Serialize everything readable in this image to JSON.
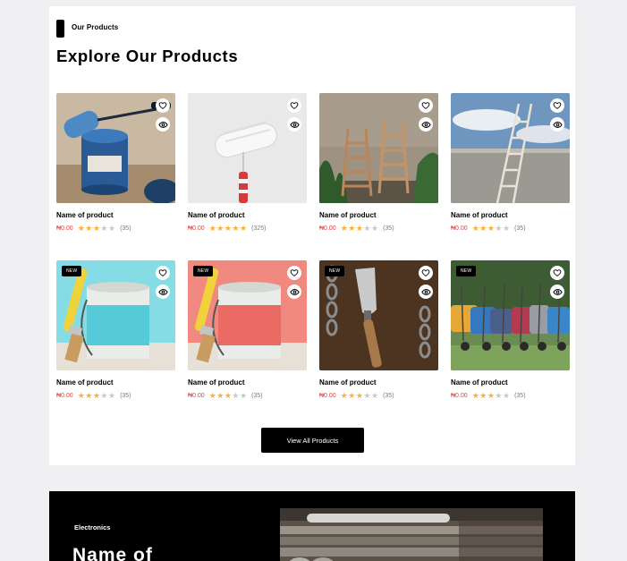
{
  "section": {
    "tag": "Our Products",
    "title": "Explore Our Products"
  },
  "products": [
    {
      "name": "Name of product",
      "price": "₦0.00",
      "rating": 3,
      "reviews": "(35)",
      "is_new": false,
      "badge": "",
      "image": "blue-paint-can-roller"
    },
    {
      "name": "Name of product",
      "price": "₦0.00",
      "rating": 5,
      "reviews": "(325)",
      "is_new": false,
      "badge": "",
      "image": "white-paint-roller"
    },
    {
      "name": "Name of product",
      "price": "₦0.00",
      "rating": 3,
      "reviews": "(35)",
      "is_new": false,
      "badge": "",
      "image": "wooden-stepladders"
    },
    {
      "name": "Name of product",
      "price": "₦0.00",
      "rating": 3,
      "reviews": "(35)",
      "is_new": false,
      "badge": "",
      "image": "ladder-against-wall"
    },
    {
      "name": "Name of product",
      "price": "₦0.00",
      "rating": 3,
      "reviews": "(35)",
      "is_new": true,
      "badge": "NEW",
      "image": "cyan-paint-can-brush"
    },
    {
      "name": "Name of product",
      "price": "₦0.00",
      "rating": 3,
      "reviews": "(35)",
      "is_new": true,
      "badge": "NEW",
      "image": "red-paint-can-brush"
    },
    {
      "name": "Name of product",
      "price": "₦0.00",
      "rating": 3,
      "reviews": "(35)",
      "is_new": true,
      "badge": "NEW",
      "image": "garden-trowel-chains"
    },
    {
      "name": "Name of product",
      "price": "₦0.00",
      "rating": 3,
      "reviews": "(35)",
      "is_new": true,
      "badge": "NEW",
      "image": "wheelbarrows-row"
    }
  ],
  "actions": {
    "view_all": "View All Products"
  },
  "banner": {
    "category": "Electronics",
    "title": "Name of",
    "image": "steel-pipes"
  },
  "colors": {
    "accent": "#db4444",
    "star": "#ffad33",
    "star_off": "#c8c8c8",
    "button": "#000000",
    "page_bg": "#f0f0f2"
  },
  "icons": [
    "heart-icon",
    "eye-icon",
    "star-icon"
  ]
}
